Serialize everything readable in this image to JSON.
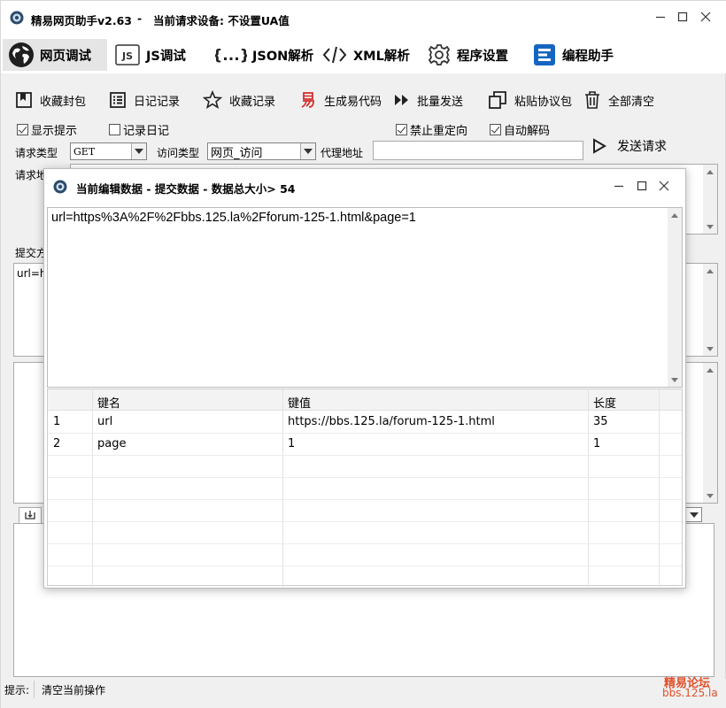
{
  "app": {
    "title": "精易网页助手v2.63",
    "separator": "-",
    "device_label": "当前请求设备: 不设置UA值"
  },
  "tabs": [
    {
      "label": "网页调试",
      "icon": "globe-icon",
      "active": true
    },
    {
      "label": "JS调试",
      "icon": "js-icon"
    },
    {
      "label": "JSON解析",
      "icon": "braces-icon"
    },
    {
      "label": "XML解析",
      "icon": "code-icon"
    },
    {
      "label": "程序设置",
      "icon": "gear-icon"
    },
    {
      "label": "编程助手",
      "icon": "editor-icon"
    }
  ],
  "toolbar": [
    {
      "label": "收藏封包",
      "icon": "bookmark-icon"
    },
    {
      "label": "日记记录",
      "icon": "list-icon"
    },
    {
      "label": "收藏记录",
      "icon": "star-icon"
    },
    {
      "label": "生成易代码",
      "icon": "yi-icon"
    },
    {
      "label": "批量发送",
      "icon": "fast-forward-icon"
    },
    {
      "label": "粘贴协议包",
      "icon": "paste-icon"
    },
    {
      "label": "全部清空",
      "icon": "trash-icon"
    }
  ],
  "options": {
    "show_hint": {
      "label": "显示提示",
      "checked": true
    },
    "log_diary": {
      "label": "记录日记",
      "checked": false
    },
    "no_redirect": {
      "label": "禁止重定向",
      "checked": true
    },
    "auto_decode": {
      "label": "自动解码",
      "checked": true
    }
  },
  "request": {
    "method_label": "请求类型",
    "method_value": "GET",
    "visit_label": "访问类型",
    "visit_value": "网页_访问",
    "proxy_label": "代理地址",
    "proxy_value": "",
    "send_label": "发送请求",
    "addr_label_partial": "请求地",
    "submit_label_partial": "提交方",
    "submit_value_partial": "url=h"
  },
  "dialog": {
    "title": "当前编辑数据 - 提交数据 - 数据总大小> 54",
    "raw_text": "url=https%3A%2F%2Fbbs.125.la%2Fforum-125-1.html&page=1",
    "columns": [
      "键名",
      "键值",
      "长度"
    ],
    "rows": [
      {
        "index": "1",
        "key": "url",
        "value": "https://bbs.125.la/forum-125-1.html",
        "length": "35"
      },
      {
        "index": "2",
        "key": "page",
        "value": "1",
        "length": "1"
      }
    ]
  },
  "status": {
    "label": "提示:",
    "message": "清空当前操作"
  },
  "watermark": {
    "line1": "精易论坛",
    "line2": "bbs.125.la"
  },
  "colors": {
    "accent_blue": "#1565c0",
    "yi_red": "#d32f2f",
    "watermark_red": "#e0502a"
  }
}
